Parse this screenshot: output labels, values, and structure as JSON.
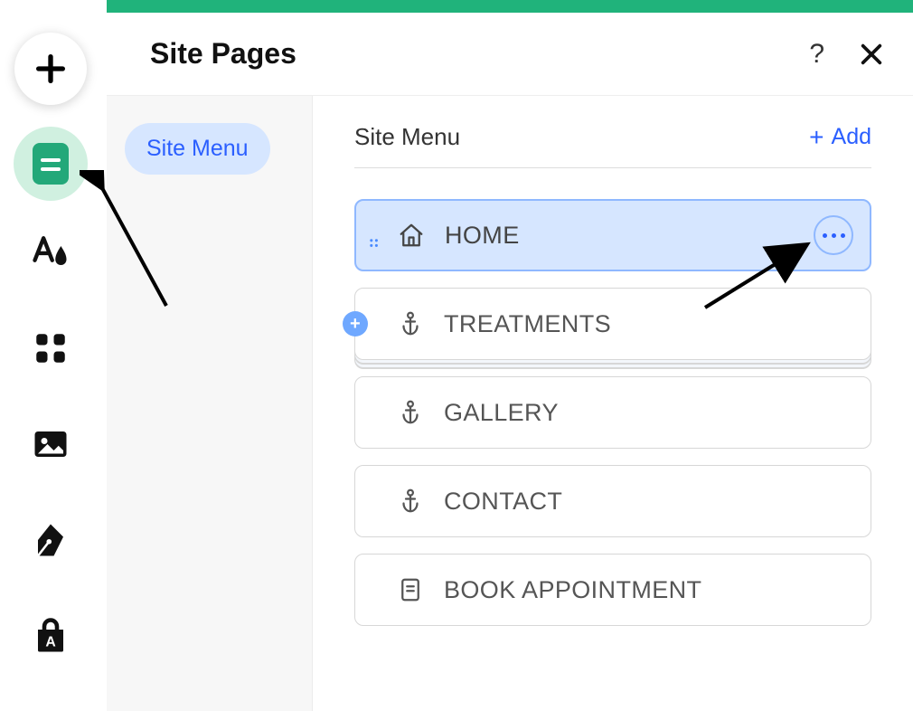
{
  "panel": {
    "title": "Site Pages"
  },
  "sidebar": {
    "pill_label": "Site Menu"
  },
  "main": {
    "heading": "Site Menu",
    "add_label": "Add"
  },
  "pages": [
    {
      "label": "HOME",
      "icon": "home",
      "selected": true,
      "has_more": true,
      "has_drag": true
    },
    {
      "label": "TREATMENTS",
      "icon": "anchor",
      "stacked": true,
      "has_badge_plus": true
    },
    {
      "label": "GALLERY",
      "icon": "anchor"
    },
    {
      "label": "CONTACT",
      "icon": "anchor"
    },
    {
      "label": "BOOK APPOINTMENT",
      "icon": "page"
    }
  ]
}
